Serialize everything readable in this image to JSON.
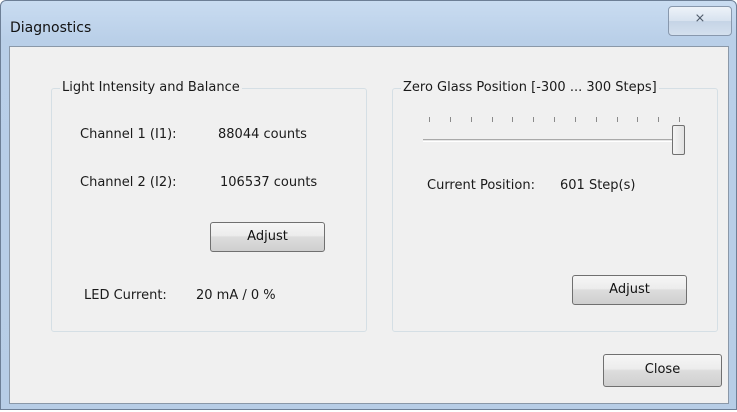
{
  "window": {
    "title": "Diagnostics",
    "close_glyph": "⨯"
  },
  "light_group": {
    "title": "Light Intensity and Balance",
    "channel1_label": "Channel 1 (I1):",
    "channel1_value": "88044 counts",
    "channel2_label": "Channel 2 (I2):",
    "channel2_value": "106537 counts",
    "adjust_label": "Adjust",
    "led_label": "LED Current:",
    "led_value": "20 mA / 0 %"
  },
  "zero_group": {
    "title": "Zero Glass Position [-300 ... 300 Steps]",
    "slider_value": 601,
    "slider_min": 0,
    "slider_max": 601,
    "tick_count": 13,
    "position_label": "Current Position:",
    "position_value": "601 Step(s)",
    "adjust_label": "Adjust"
  },
  "footer": {
    "close_label": "Close"
  },
  "icons": {
    "close": "close-icon"
  },
  "colors": {
    "titlebar": "#c9dcf1",
    "client_bg": "#f0f0f0",
    "groupbox_border": "#d5dfe5"
  }
}
